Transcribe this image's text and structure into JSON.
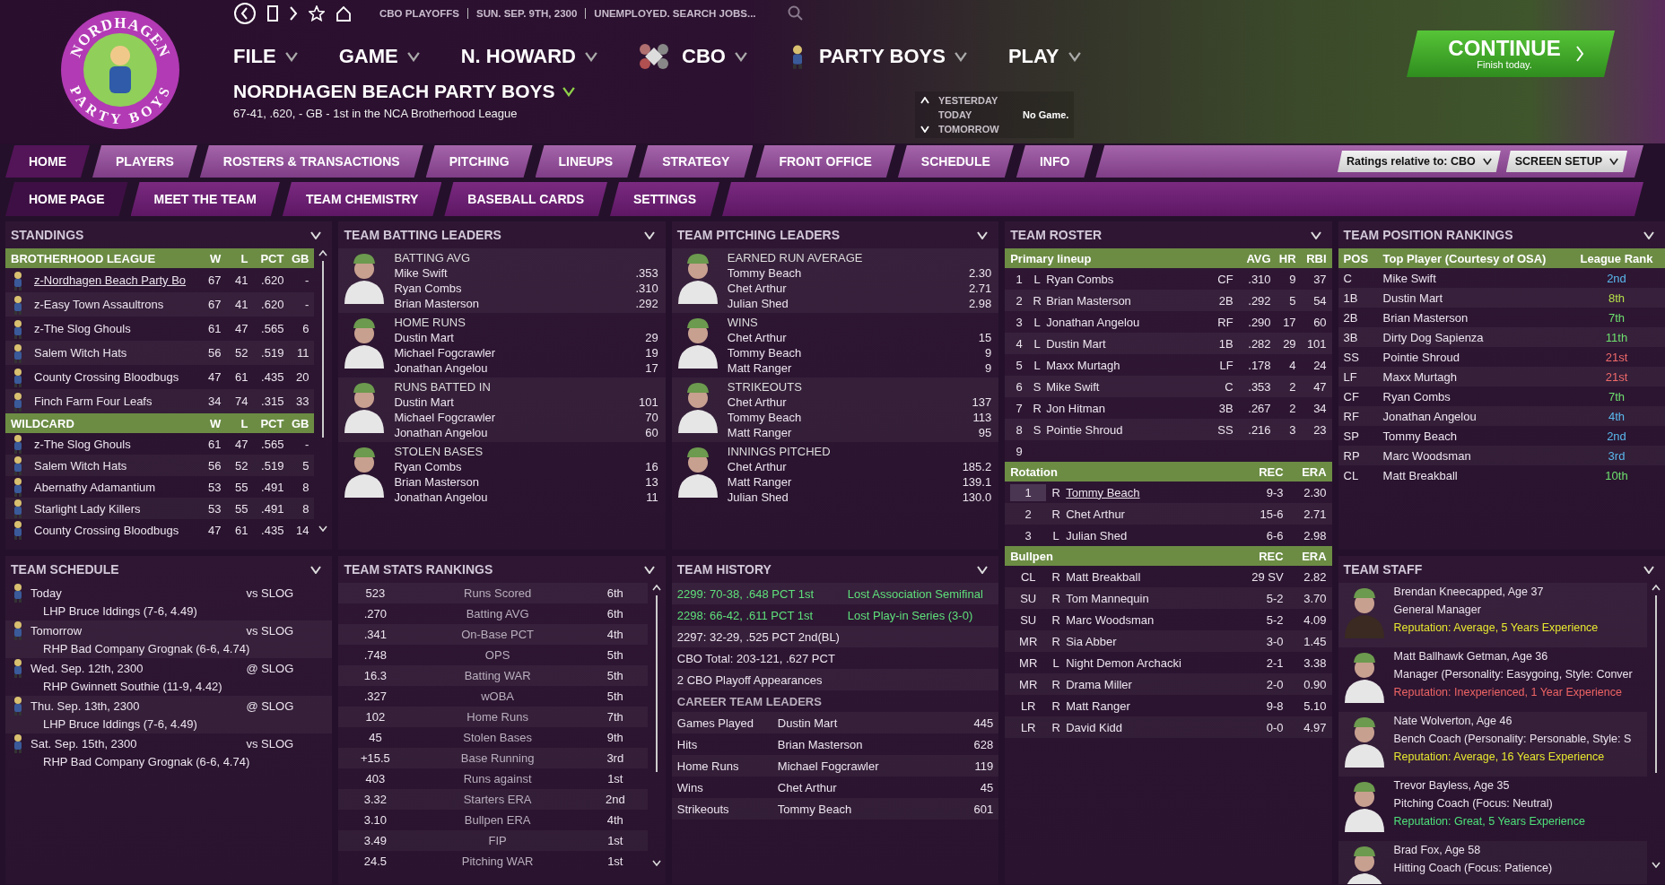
{
  "logo": {
    "top_text": "NORDHAGEN",
    "bottom_text": "PARTY BOYS"
  },
  "top_bar": {
    "breadcrumbs": [
      "CBO PLAYOFFS",
      "SUN. SEP. 9TH, 2300",
      "UNEMPLOYED. SEARCH JOBS..."
    ]
  },
  "menus": [
    {
      "label": "FILE",
      "kind": "plain"
    },
    {
      "label": "GAME",
      "kind": "plain"
    },
    {
      "label": "N. HOWARD",
      "kind": "plain"
    },
    {
      "label": "CBO",
      "kind": "league"
    },
    {
      "label": "PARTY BOYS",
      "kind": "team"
    },
    {
      "label": "PLAY",
      "kind": "plain"
    }
  ],
  "team": {
    "name": "NORDHAGEN BEACH PARTY BOYS",
    "record": "67-41, .620, - GB - 1st in the NCA Brotherhood League"
  },
  "day_nav": {
    "yesterday": "YESTERDAY",
    "today": "TODAY",
    "tomorrow": "TOMORROW",
    "today_result": "No Game."
  },
  "continue_button": {
    "label": "CONTINUE",
    "sublabel": "Finish today."
  },
  "tabs": [
    {
      "label": "HOME",
      "selected": true
    },
    {
      "label": "PLAYERS",
      "selected": false
    },
    {
      "label": "ROSTERS & TRANSACTIONS",
      "selected": false
    },
    {
      "label": "PITCHING",
      "selected": false
    },
    {
      "label": "LINEUPS",
      "selected": false
    },
    {
      "label": "STRATEGY",
      "selected": false
    },
    {
      "label": "FRONT OFFICE",
      "selected": false
    },
    {
      "label": "SCHEDULE",
      "selected": false
    },
    {
      "label": "INFO",
      "selected": false
    }
  ],
  "tab_dropdowns": [
    "Ratings relative to: CBO",
    "SCREEN SETUP"
  ],
  "subtabs": [
    {
      "label": "HOME PAGE",
      "selected": true
    },
    {
      "label": "MEET THE TEAM",
      "selected": false
    },
    {
      "label": "TEAM CHEMISTRY",
      "selected": false
    },
    {
      "label": "BASEBALL CARDS",
      "selected": false
    },
    {
      "label": "SETTINGS",
      "selected": false
    }
  ],
  "standings": {
    "title": "STANDINGS",
    "groups": [
      {
        "name": "BROTHERHOOD LEAGUE",
        "columns": [
          "W",
          "L",
          "PCT",
          "GB"
        ],
        "rows": [
          {
            "team": "z-Nordhagen Beach Party Bo",
            "w": "67",
            "l": "41",
            "pct": ".620",
            "gb": "-",
            "current": true
          },
          {
            "team": "z-Easy Town Assaultrons",
            "w": "67",
            "l": "41",
            "pct": ".620",
            "gb": "-",
            "current": false
          },
          {
            "team": "z-The Slog Ghouls",
            "w": "61",
            "l": "47",
            "pct": ".565",
            "gb": "6",
            "current": false
          },
          {
            "team": "Salem Witch Hats",
            "w": "56",
            "l": "52",
            "pct": ".519",
            "gb": "11",
            "current": false
          },
          {
            "team": "County Crossing Bloodbugs",
            "w": "47",
            "l": "61",
            "pct": ".435",
            "gb": "20",
            "current": false
          },
          {
            "team": "Finch Farm Four Leafs",
            "w": "34",
            "l": "74",
            "pct": ".315",
            "gb": "33",
            "current": false
          }
        ]
      },
      {
        "name": "WILDCARD",
        "columns": [
          "W",
          "L",
          "PCT",
          "GB"
        ],
        "rows": [
          {
            "team": "z-The Slog Ghouls",
            "w": "61",
            "l": "47",
            "pct": ".565",
            "gb": "-",
            "current": false
          },
          {
            "team": "Salem Witch Hats",
            "w": "56",
            "l": "52",
            "pct": ".519",
            "gb": "5",
            "current": false
          },
          {
            "team": "Abernathy Adamantium",
            "w": "53",
            "l": "55",
            "pct": ".491",
            "gb": "8",
            "current": false
          },
          {
            "team": "Starlight Lady Killers",
            "w": "53",
            "l": "55",
            "pct": ".491",
            "gb": "8",
            "current": false
          },
          {
            "team": "County Crossing Bloodbugs",
            "w": "47",
            "l": "61",
            "pct": ".435",
            "gb": "14",
            "current": false
          }
        ]
      }
    ]
  },
  "batting_leaders": {
    "title": "TEAM BATTING LEADERS",
    "categories": [
      {
        "name": "BATTING AVG",
        "leaders": [
          {
            "player": "Mike Swift",
            "value": ".353"
          },
          {
            "player": "Ryan Combs",
            "value": ".310"
          },
          {
            "player": "Brian Masterson",
            "value": ".292"
          }
        ]
      },
      {
        "name": "HOME RUNS",
        "leaders": [
          {
            "player": "Dustin Mart",
            "value": "29"
          },
          {
            "player": "Michael Fogcrawler",
            "value": "19"
          },
          {
            "player": "Jonathan Angelou",
            "value": "17"
          }
        ]
      },
      {
        "name": "RUNS BATTED IN",
        "leaders": [
          {
            "player": "Dustin Mart",
            "value": "101"
          },
          {
            "player": "Michael Fogcrawler",
            "value": "70"
          },
          {
            "player": "Jonathan Angelou",
            "value": "60"
          }
        ]
      },
      {
        "name": "STOLEN BASES",
        "leaders": [
          {
            "player": "Ryan Combs",
            "value": "16"
          },
          {
            "player": "Brian Masterson",
            "value": "13"
          },
          {
            "player": "Jonathan Angelou",
            "value": "11"
          }
        ]
      }
    ]
  },
  "pitching_leaders": {
    "title": "TEAM PITCHING LEADERS",
    "categories": [
      {
        "name": "EARNED RUN AVERAGE",
        "leaders": [
          {
            "player": "Tommy Beach",
            "value": "2.30"
          },
          {
            "player": "Chet Arthur",
            "value": "2.71"
          },
          {
            "player": "Julian Shed",
            "value": "2.98"
          }
        ]
      },
      {
        "name": "WINS",
        "leaders": [
          {
            "player": "Chet Arthur",
            "value": "15"
          },
          {
            "player": "Tommy Beach",
            "value": "9"
          },
          {
            "player": "Matt Ranger",
            "value": "9"
          }
        ]
      },
      {
        "name": "STRIKEOUTS",
        "leaders": [
          {
            "player": "Chet Arthur",
            "value": "137"
          },
          {
            "player": "Tommy Beach",
            "value": "113"
          },
          {
            "player": "Matt Ranger",
            "value": "95"
          }
        ]
      },
      {
        "name": "INNINGS PITCHED",
        "leaders": [
          {
            "player": "Chet Arthur",
            "value": "185.2"
          },
          {
            "player": "Matt Ranger",
            "value": "139.1"
          },
          {
            "player": "Julian Shed",
            "value": "130.0"
          }
        ]
      }
    ]
  },
  "roster": {
    "title": "TEAM ROSTER",
    "sections": [
      {
        "kind": "lineup",
        "columns": [
          "Primary lineup",
          "",
          "",
          "",
          "AVG",
          "HR",
          "RBI"
        ],
        "rows": [
          {
            "cells": [
              "1",
              "L",
              "Ryan Combs",
              "CF",
              ".310",
              "9",
              "37"
            ]
          },
          {
            "cells": [
              "2",
              "R",
              "Brian Masterson",
              "2B",
              ".292",
              "5",
              "54"
            ]
          },
          {
            "cells": [
              "3",
              "L",
              "Jonathan Angelou",
              "RF",
              ".290",
              "17",
              "60"
            ]
          },
          {
            "cells": [
              "4",
              "L",
              "Dustin Mart",
              "1B",
              ".282",
              "29",
              "101"
            ]
          },
          {
            "cells": [
              "5",
              "L",
              "Maxx Murtagh",
              "LF",
              ".178",
              "4",
              "24"
            ]
          },
          {
            "cells": [
              "6",
              "S",
              "Mike Swift",
              "C",
              ".353",
              "2",
              "47"
            ]
          },
          {
            "cells": [
              "7",
              "R",
              "Jon Hitman",
              "3B",
              ".267",
              "2",
              "34"
            ]
          },
          {
            "cells": [
              "8",
              "S",
              "Pointie Shroud",
              "SS",
              ".216",
              "3",
              "23"
            ]
          },
          {
            "cells": [
              "9"
            ]
          }
        ]
      },
      {
        "kind": "pitchers",
        "columns": [
          "Rotation",
          "",
          "",
          "REC",
          "ERA"
        ],
        "rows": [
          {
            "cells": [
              "1",
              "R",
              "Tommy Beach",
              "9-3",
              "2.30"
            ],
            "selected": true
          },
          {
            "cells": [
              "2",
              "R",
              "Chet Arthur",
              "15-6",
              "2.71"
            ],
            "selected": false
          },
          {
            "cells": [
              "3",
              "L",
              "Julian Shed",
              "6-6",
              "2.98"
            ],
            "selected": false
          }
        ]
      },
      {
        "kind": "pitchers",
        "columns": [
          "Bullpen",
          "",
          "",
          "REC",
          "ERA"
        ],
        "rows": [
          {
            "cells": [
              "CL",
              "R",
              "Matt Breakball",
              "29 SV",
              "2.82"
            ]
          },
          {
            "cells": [
              "SU",
              "R",
              "Tom Mannequin",
              "5-2",
              "3.70"
            ]
          },
          {
            "cells": [
              "SU",
              "R",
              "Marc Woodsman",
              "5-2",
              "4.09"
            ]
          },
          {
            "cells": [
              "MR",
              "R",
              "Sia Abber",
              "3-0",
              "1.45"
            ]
          },
          {
            "cells": [
              "MR",
              "L",
              "Night Demon Archacki",
              "2-1",
              "3.38"
            ]
          },
          {
            "cells": [
              "MR",
              "R",
              "Drama Miller",
              "2-0",
              "0.90"
            ]
          },
          {
            "cells": [
              "LR",
              "R",
              "Matt Ranger",
              "9-8",
              "5.10"
            ]
          },
          {
            "cells": [
              "LR",
              "R",
              "David Kidd",
              "0-0",
              "4.97"
            ]
          }
        ]
      }
    ]
  },
  "position_rankings": {
    "title": "TEAM POSITION RANKINGS",
    "columns": [
      "POS",
      "Top Player (Courtesy of OSA)",
      "League Rank"
    ],
    "rows": [
      {
        "pos": "C",
        "player": "Mike Swift",
        "rank": "2nd",
        "color": "#5ab8ec"
      },
      {
        "pos": "1B",
        "player": "Dustin Mart",
        "rank": "8th",
        "color": "#b4e04a"
      },
      {
        "pos": "2B",
        "player": "Brian Masterson",
        "rank": "7th",
        "color": "#6ee06e"
      },
      {
        "pos": "3B",
        "player": "Dirty Dog Sapienza",
        "rank": "11th",
        "color": "#6ee06e"
      },
      {
        "pos": "SS",
        "player": "Pointie Shroud",
        "rank": "21st",
        "color": "#f06a6a"
      },
      {
        "pos": "LF",
        "player": "Maxx Murtagh",
        "rank": "21st",
        "color": "#f06a6a"
      },
      {
        "pos": "CF",
        "player": "Ryan Combs",
        "rank": "7th",
        "color": "#6ee06e"
      },
      {
        "pos": "RF",
        "player": "Jonathan Angelou",
        "rank": "4th",
        "color": "#5ab8ec"
      },
      {
        "pos": "SP",
        "player": "Tommy Beach",
        "rank": "2nd",
        "color": "#5ab8ec"
      },
      {
        "pos": "RP",
        "player": "Marc Woodsman",
        "rank": "3rd",
        "color": "#5ab8ec"
      },
      {
        "pos": "CL",
        "player": "Matt Breakball",
        "rank": "10th",
        "color": "#6ee06e"
      }
    ]
  },
  "schedule": {
    "title": "TEAM SCHEDULE",
    "games": [
      {
        "date": "Today",
        "opponent": "vs SLOG",
        "pitcher": "LHP Bruce Iddings (7-6, 4.49)"
      },
      {
        "date": "Tomorrow",
        "opponent": "vs SLOG",
        "pitcher": "RHP Bad Company Grognak (6-6, 4.74)"
      },
      {
        "date": "Wed. Sep. 12th, 2300",
        "opponent": "@ SLOG",
        "pitcher": "RHP Gwinnett Southie (11-9, 4.42)"
      },
      {
        "date": "Thu. Sep. 13th, 2300",
        "opponent": "@ SLOG",
        "pitcher": "LHP Bruce Iddings (7-6, 4.49)"
      },
      {
        "date": "Sat. Sep. 15th, 2300",
        "opponent": "vs SLOG",
        "pitcher": "RHP Bad Company Grognak (6-6, 4.74)"
      }
    ]
  },
  "stats_rankings": {
    "title": "TEAM STATS RANKINGS",
    "rows": [
      {
        "value": "523",
        "stat": "Runs Scored",
        "rank": "6th"
      },
      {
        "value": ".270",
        "stat": "Batting AVG",
        "rank": "6th"
      },
      {
        "value": ".341",
        "stat": "On-Base PCT",
        "rank": "4th"
      },
      {
        "value": ".748",
        "stat": "OPS",
        "rank": "5th"
      },
      {
        "value": "16.3",
        "stat": "Batting WAR",
        "rank": "5th"
      },
      {
        "value": ".327",
        "stat": "wOBA",
        "rank": "5th"
      },
      {
        "value": "102",
        "stat": "Home Runs",
        "rank": "7th"
      },
      {
        "value": "45",
        "stat": "Stolen Bases",
        "rank": "9th"
      },
      {
        "value": "+15.5",
        "stat": "Base Running",
        "rank": "3rd"
      },
      {
        "value": "403",
        "stat": "Runs against",
        "rank": "1st"
      },
      {
        "value": "3.32",
        "stat": "Starters ERA",
        "rank": "2nd"
      },
      {
        "value": "3.10",
        "stat": "Bullpen ERA",
        "rank": "4th"
      },
      {
        "value": "3.49",
        "stat": "FIP",
        "rank": "1st"
      },
      {
        "value": "24.5",
        "stat": "Pitching WAR",
        "rank": "1st"
      }
    ]
  },
  "history": {
    "title": "TEAM HISTORY",
    "seasons": [
      {
        "summary": "2299: 70-38, .648 PCT 1st",
        "result": "Lost Association Semifinal",
        "playoff": true
      },
      {
        "summary": "2298: 66-42, .611 PCT 1st",
        "result": "Lost Play-in Series (3-0)",
        "playoff": true
      },
      {
        "summary": "2297: 32-29, .525 PCT 2nd(BL)",
        "playoff": false
      }
    ],
    "totals": [
      "CBO Total: 203-121, .627 PCT",
      "2 CBO Playoff Appearances"
    ],
    "career_title": "CAREER TEAM LEADERS",
    "career": [
      {
        "category": "Games Played",
        "player": "Dustin Mart",
        "value": "445"
      },
      {
        "category": "Hits",
        "player": "Brian Masterson",
        "value": "628"
      },
      {
        "category": "Home Runs",
        "player": "Michael Fogcrawler",
        "value": "119"
      },
      {
        "category": "Wins",
        "player": "Chet Arthur",
        "value": "45"
      },
      {
        "category": "Strikeouts",
        "player": "Tommy Beach",
        "value": "601"
      }
    ]
  },
  "staff": {
    "title": "TEAM STAFF",
    "members": [
      {
        "name": "Brendan Kneecapped, Age 37",
        "role": "General Manager",
        "reputation": "Reputation: Average, 5 Years Experience",
        "color": "#e8e830"
      },
      {
        "name": "Matt Ballhawk Getman, Age 36",
        "role": "Manager (Personality: Easygoing, Style: Conver",
        "reputation": "Reputation: Inexperienced, 1 Year Experience",
        "color": "#ee6464"
      },
      {
        "name": "Nate Wolverton, Age 46",
        "role": "Bench Coach (Personality: Personable, Style: S",
        "reputation": "Reputation: Average, 16 Years Experience",
        "color": "#e8e830"
      },
      {
        "name": "Trevor Bayless, Age 35",
        "role": "Pitching Coach (Focus: Neutral)",
        "reputation": "Reputation: Great, 5 Years Experience",
        "color": "#4ee07a"
      },
      {
        "name": "Brad Fox, Age 58",
        "role": "Hitting Coach (Focus: Patience)"
      }
    ]
  }
}
